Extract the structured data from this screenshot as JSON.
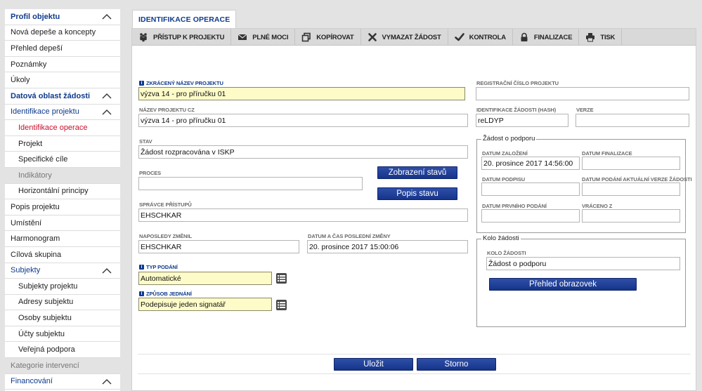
{
  "sidebar": {
    "items": [
      {
        "label": "Profil objektu",
        "kind": "section",
        "chevron": true
      },
      {
        "label": "Nová depeše a koncepty",
        "kind": "item"
      },
      {
        "label": "Přehled depeší",
        "kind": "item"
      },
      {
        "label": "Poznámky",
        "kind": "item"
      },
      {
        "label": "Úkoly",
        "kind": "item"
      },
      {
        "label": "Datová oblast žádosti",
        "kind": "section",
        "chevron": true
      },
      {
        "label": "Identifikace projektu",
        "kind": "section-plain",
        "chevron": true
      },
      {
        "label": "Identifikace operace",
        "kind": "child-active"
      },
      {
        "label": "Projekt",
        "kind": "child"
      },
      {
        "label": "Specifické cíle",
        "kind": "child"
      },
      {
        "label": "Indikátory",
        "kind": "child-disabled"
      },
      {
        "label": "Horizontální principy",
        "kind": "child"
      },
      {
        "label": "Popis projektu",
        "kind": "item"
      },
      {
        "label": "Umístění",
        "kind": "item"
      },
      {
        "label": "Harmonogram",
        "kind": "item"
      },
      {
        "label": "Cílová skupina",
        "kind": "item"
      },
      {
        "label": "Subjekty",
        "kind": "section-plain",
        "chevron": true
      },
      {
        "label": "Subjekty projektu",
        "kind": "child"
      },
      {
        "label": "Adresy subjektu",
        "kind": "child"
      },
      {
        "label": "Osoby subjektu",
        "kind": "child"
      },
      {
        "label": "Účty subjektu",
        "kind": "child"
      },
      {
        "label": "Veřejná podpora",
        "kind": "child"
      },
      {
        "label": "Kategorie intervencí",
        "kind": "disabled"
      },
      {
        "label": "Financování",
        "kind": "section-plain",
        "chevron": true
      }
    ]
  },
  "tab": {
    "label": "IDENTIFIKACE OPERACE"
  },
  "toolbar": [
    {
      "label": "PŘÍSTUP K PROJEKTU",
      "icon": "people-icon"
    },
    {
      "label": "PLNÉ MOCI",
      "icon": "envelope-icon"
    },
    {
      "label": "KOPÍROVAT",
      "icon": "copy-icon"
    },
    {
      "label": "VYMAZAT ŽÁDOST",
      "icon": "delete-x-icon"
    },
    {
      "label": "KONTROLA",
      "icon": "checkmark-icon"
    },
    {
      "label": "FINALIZACE",
      "icon": "lock-icon"
    },
    {
      "label": "TISK",
      "icon": "printer-icon"
    }
  ],
  "form": {
    "zkraceny_nazev": {
      "label": "ZKRÁCENÝ NÁZEV PROJEKTU",
      "value": "výzva 14 - pro příručku 01"
    },
    "nazev_cz": {
      "label": "NÁZEV PROJEKTU CZ",
      "value": "výzva 14 - pro příručku 01"
    },
    "stav": {
      "label": "STAV",
      "value": "Žádost rozpracována v ISKP"
    },
    "proces": {
      "label": "PROCES",
      "value": ""
    },
    "zobrazeni_stavu": "Zobrazení stavů",
    "popis_stavu": "Popis stavu",
    "spravce": {
      "label": "SPRÁVCE PŘÍSTUPŮ",
      "value": "EHSCHKAR"
    },
    "naposledy_zmenil": {
      "label": "NAPOSLEDY ZMĚNIL",
      "value": "EHSCHKAR"
    },
    "datum_zmeny": {
      "label": "DATUM A ČAS POSLEDNÍ ZMĚNY",
      "value": "20. prosince 2017 15:00:06"
    },
    "typ_podani": {
      "label": "TYP PODÁNÍ",
      "value": "Automatické"
    },
    "zpusob_jednani": {
      "label": "ZPŮSOB JEDNÁNÍ",
      "value": "Podepisuje jeden signatář"
    },
    "registracni_cislo": {
      "label": "REGISTRAČNÍ ČÍSLO PROJEKTU",
      "value": ""
    },
    "hash": {
      "label": "IDENTIFIKACE ŽÁDOSTI (HASH)",
      "value": "reLDYP"
    },
    "verze": {
      "label": "VERZE",
      "value": ""
    },
    "zadost_o_podporu": {
      "legend": "Žádost o podporu",
      "datum_zalozeni": {
        "label": "DATUM ZALOŽENÍ",
        "value": "20. prosince 2017 14:56:00"
      },
      "datum_finalizace": {
        "label": "DATUM FINALIZACE",
        "value": ""
      },
      "datum_podpisu": {
        "label": "DATUM PODPISU",
        "value": ""
      },
      "datum_podani_verze": {
        "label": "DATUM PODÁNÍ AKTUÁLNÍ VERZE ŽÁDOSTI",
        "value": ""
      },
      "datum_prvniho_podani": {
        "label": "DATUM PRVNÍHO PODÁNÍ",
        "value": ""
      },
      "vraceno_z": {
        "label": "VRÁCENO Z",
        "value": ""
      }
    },
    "kolo_zadosti": {
      "legend": "Kolo žádosti",
      "field": {
        "label": "KOLO ŽÁDOSTI",
        "value": "Žádost o podporu"
      },
      "prehled_button": "Přehled obrazovek"
    }
  },
  "footer": {
    "ulozit": "Uložit",
    "storno": "Storno"
  },
  "colors": {
    "accent_blue": "#0e3a8c",
    "active_red": "#c8102e",
    "required_yellow": "#fdfbc8",
    "button_blue": "#16348a"
  }
}
